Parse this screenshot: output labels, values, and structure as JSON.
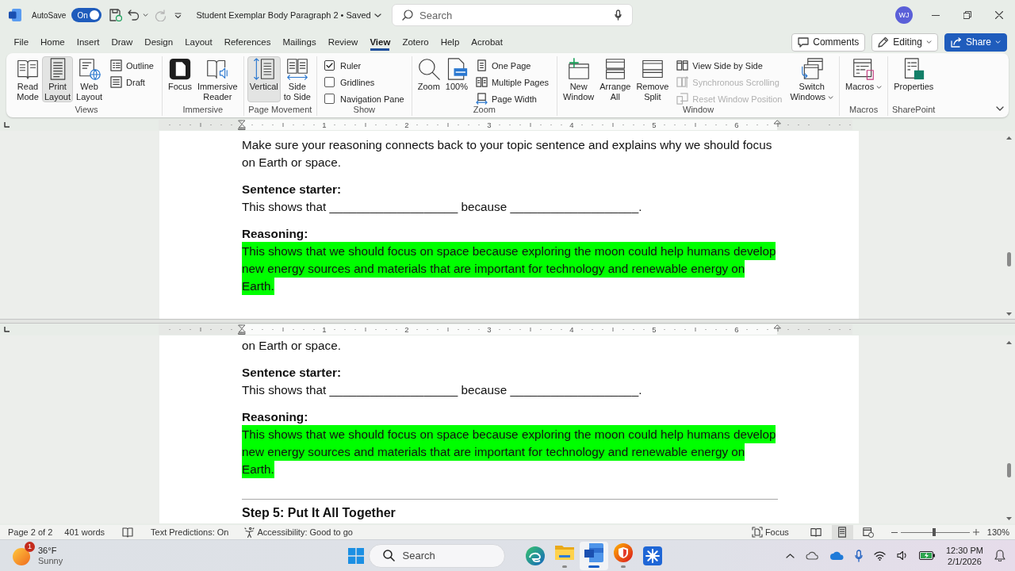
{
  "title_bar": {
    "autosave": {
      "label": "AutoSave",
      "on": true,
      "state_label": "On"
    },
    "document_title": "Student Exemplar Body Paragraph 2 • Saved",
    "search": {
      "placeholder": "Search"
    },
    "avatar": "WJ"
  },
  "menu_tabs": [
    {
      "label": "File",
      "selected": false
    },
    {
      "label": "Home",
      "selected": false
    },
    {
      "label": "Insert",
      "selected": false
    },
    {
      "label": "Draw",
      "selected": false
    },
    {
      "label": "Design",
      "selected": false
    },
    {
      "label": "Layout",
      "selected": false
    },
    {
      "label": "References",
      "selected": false
    },
    {
      "label": "Mailings",
      "selected": false
    },
    {
      "label": "Review",
      "selected": false
    },
    {
      "label": "View",
      "selected": true
    },
    {
      "label": "Zotero",
      "selected": false
    },
    {
      "label": "Help",
      "selected": false
    },
    {
      "label": "Acrobat",
      "selected": false
    }
  ],
  "menu_actions": {
    "comments": "Comments",
    "editing": "Editing",
    "share": "Share"
  },
  "ribbon": {
    "groups": [
      {
        "label": "Views",
        "items": [
          {
            "kind": "large",
            "label": "Read\nMode",
            "selected": false
          },
          {
            "kind": "large",
            "label": "Print\nLayout",
            "selected": true
          },
          {
            "kind": "large",
            "label": "Web\nLayout",
            "selected": false
          },
          {
            "kind": "small",
            "label": "Outline",
            "selected": false
          },
          {
            "kind": "small",
            "label": "Draft",
            "selected": false
          }
        ]
      },
      {
        "label": "Immersive",
        "items": [
          {
            "kind": "large",
            "label": "Focus"
          },
          {
            "kind": "large",
            "label": "Immersive\nReader"
          }
        ]
      },
      {
        "label": "Page Movement",
        "items": [
          {
            "kind": "large",
            "label": "Vertical",
            "selected": true
          },
          {
            "kind": "large",
            "label": "Side\nto Side",
            "selected": false
          }
        ]
      },
      {
        "label": "Show",
        "items": [
          {
            "kind": "check",
            "label": "Ruler",
            "checked": true
          },
          {
            "kind": "check",
            "label": "Gridlines",
            "checked": false
          },
          {
            "kind": "check",
            "label": "Navigation Pane",
            "checked": false
          }
        ]
      },
      {
        "label": "Zoom",
        "items": [
          {
            "kind": "large",
            "label": "Zoom"
          },
          {
            "kind": "large",
            "label": "100%"
          },
          {
            "kind": "small",
            "label": "One Page"
          },
          {
            "kind": "small",
            "label": "Multiple Pages"
          },
          {
            "kind": "small",
            "label": "Page Width"
          }
        ]
      },
      {
        "label": "Window",
        "items": [
          {
            "kind": "large",
            "label": "New\nWindow"
          },
          {
            "kind": "large",
            "label": "Arrange\nAll"
          },
          {
            "kind": "large",
            "label": "Remove\nSplit"
          },
          {
            "kind": "small",
            "label": "View Side by Side",
            "disabled": false
          },
          {
            "kind": "small",
            "label": "Synchronous Scrolling",
            "disabled": true
          },
          {
            "kind": "small",
            "label": "Reset Window Position",
            "disabled": true
          },
          {
            "kind": "large",
            "label": "Switch\nWindows",
            "dropdown": true
          }
        ]
      },
      {
        "label": "Macros",
        "items": [
          {
            "kind": "large",
            "label": "Macros",
            "dropdown": true
          }
        ]
      },
      {
        "label": "SharePoint",
        "items": [
          {
            "kind": "large",
            "label": "Properties"
          }
        ]
      }
    ]
  },
  "document": {
    "panes": [
      {
        "ruler": [
          "1",
          "2",
          "3",
          "4",
          "5",
          "6"
        ],
        "blocks": [
          {
            "kind": "text",
            "text": "Make sure your reasoning connects back to your topic sentence and explains why we should focus on Earth or space."
          },
          {
            "kind": "heading",
            "text": "Sentence starter:"
          },
          {
            "kind": "text",
            "text": "This shows that ___________________ because ___________________."
          },
          {
            "kind": "heading",
            "text": "Reasoning:"
          },
          {
            "kind": "highlight",
            "text": "This shows that we should focus on space because exploring the moon could help humans develop new energy sources and materials that are important for technology and renewable energy on Earth."
          }
        ]
      },
      {
        "ruler": [
          "1",
          "2",
          "3",
          "4",
          "5",
          "6"
        ],
        "blocks": [
          {
            "kind": "text",
            "text": "on Earth or space."
          },
          {
            "kind": "heading",
            "text": "Sentence starter:"
          },
          {
            "kind": "text",
            "text": "This shows that ___________________ because ___________________."
          },
          {
            "kind": "heading",
            "text": "Reasoning:"
          },
          {
            "kind": "highlight",
            "text": "This shows that we should focus on space because exploring the moon could help humans develop new energy sources and materials that are important for technology and renewable energy on Earth."
          },
          {
            "kind": "rule"
          },
          {
            "kind": "title",
            "text": "Step 5: Put It All Together"
          }
        ]
      }
    ]
  },
  "status_bar": {
    "page": "Page 2 of 2",
    "words": "401 words",
    "text_predictions": "Text Predictions: On",
    "accessibility": "Accessibility: Good to go",
    "focus": "Focus",
    "views": [
      {
        "selected": false
      },
      {
        "selected": true
      },
      {
        "selected": false
      }
    ],
    "zoom": {
      "level": 0.49,
      "reading": "130%"
    }
  },
  "taskbar": {
    "weather": {
      "badge": "1",
      "temperature": "36°F",
      "condition": "Sunny"
    },
    "search": {
      "placeholder": "Search"
    },
    "apps": [
      {
        "kind": "browser",
        "running": false,
        "active": false
      },
      {
        "kind": "folder",
        "running": true,
        "active": false
      },
      {
        "kind": "document",
        "running": true,
        "active": true
      },
      {
        "kind": "shield",
        "running": true,
        "active": false
      },
      {
        "kind": "gear",
        "running": false,
        "active": false
      }
    ],
    "clock": {
      "time": "12:30 PM",
      "date": "2/1/2026"
    }
  }
}
